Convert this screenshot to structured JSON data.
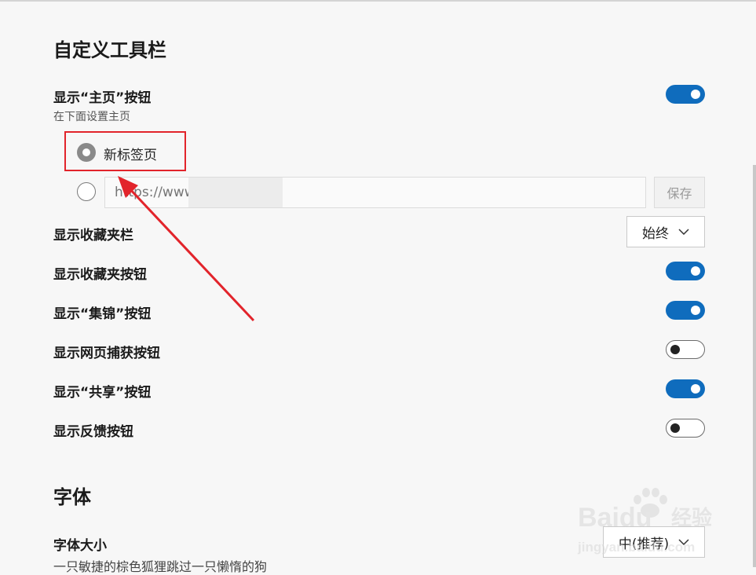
{
  "section_toolbar": {
    "title": "自定义工具栏",
    "home_button": {
      "label": "显示“主页”按钮",
      "sublabel": "在下面设置主页",
      "enabled": true,
      "options": [
        {
          "label": "新标签页",
          "selected": true
        },
        {
          "label": "",
          "selected": false
        }
      ],
      "url_placeholder": "https://www",
      "save_label": "保存"
    },
    "favorites_bar": {
      "label": "显示收藏夹栏",
      "value": "始终"
    },
    "toggles": [
      {
        "label": "显示收藏夹按钮",
        "on": true
      },
      {
        "label": "显示“集锦”按钮",
        "on": true
      },
      {
        "label": "显示网页捕获按钮",
        "on": false
      },
      {
        "label": "显示“共享”按钮",
        "on": true
      },
      {
        "label": "显示反馈按钮",
        "on": false
      }
    ]
  },
  "section_font": {
    "title": "字体",
    "font_size": {
      "label": "字体大小",
      "value": "中(推荐)",
      "preview": "一只敏捷的棕色狐狸跳过一只懒惰的狗"
    }
  },
  "colors": {
    "accent": "#0f6cbd",
    "highlight": "#e2242b"
  },
  "watermark": {
    "brand": "Baidu",
    "suffix": "经验",
    "url": "jingyan.baidu.com"
  }
}
